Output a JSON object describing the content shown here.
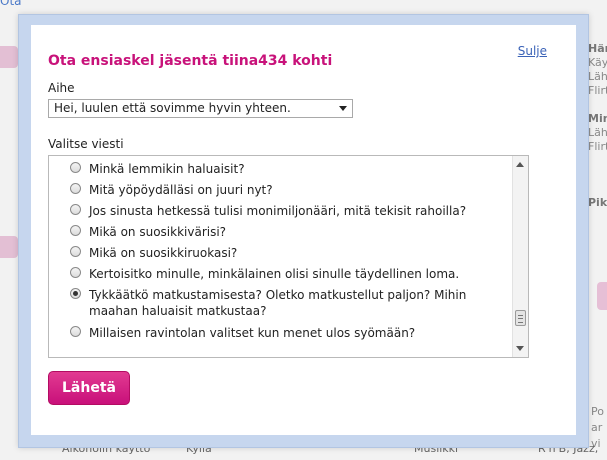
{
  "background": {
    "top_link": "Ota",
    "right_lines": [
      "Här",
      "Käy",
      "Läh",
      "Flirt",
      "",
      "Min",
      "Läh",
      "Flirt",
      "",
      "",
      "Pik"
    ],
    "bottom_row": {
      "col1": "Alkoholin käyttö",
      "col2": "Kyllä",
      "col3": "Musiikki",
      "col4": "R'n'B, Jazz,"
    },
    "right_low": [
      "Po",
      "ar",
      "vi"
    ]
  },
  "dialog": {
    "title": "Ota ensiaskel jäsentä tiina434 kohti",
    "close_label": "Sulje",
    "subject_label": "Aihe",
    "subject_value": "Hei, luulen että sovimme hyvin yhteen.",
    "message_label": "Valitse viesti",
    "options": [
      {
        "text": "Minkä lemmikin haluaisit?",
        "checked": false
      },
      {
        "text": "Mitä yöpöydälläsi on juuri nyt?",
        "checked": false
      },
      {
        "text": "Jos sinusta hetkessä tulisi monimiljonääri, mitä tekisit rahoilla?",
        "checked": false
      },
      {
        "text": "Mikä on suosikkivärisi?",
        "checked": false
      },
      {
        "text": "Mikä on suosikkiruokasi?",
        "checked": false
      },
      {
        "text": "Kertoisitko minulle, minkälainen olisi sinulle täydellinen loma.",
        "checked": false
      },
      {
        "text": "Tykkäätkö matkustamisesta? Oletko matkustellut paljon? Mihin maahan haluaisit matkustaa?",
        "checked": true
      },
      {
        "text": "Millaisen ravintolan valitset kun menet ulos syömään?",
        "checked": false
      }
    ],
    "send_label": "Lähetä"
  }
}
